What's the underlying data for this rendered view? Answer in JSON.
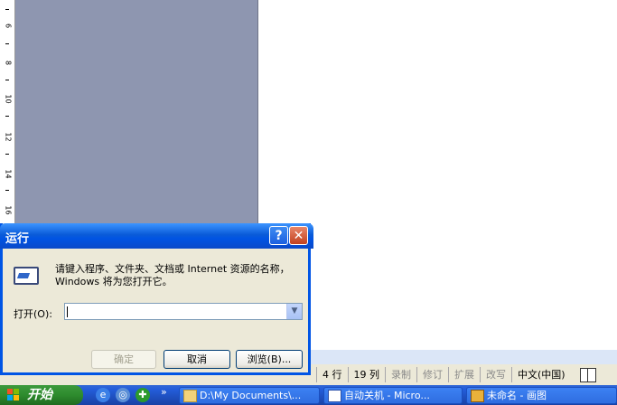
{
  "ruler": {
    "numbers": [
      "6",
      "8",
      "10",
      "12",
      "14",
      "16"
    ]
  },
  "dialog": {
    "title": "运行",
    "help_label": "?",
    "close_label": "✕",
    "description": "请键入程序、文件夹、文档或 Internet 资源的名称，Windows 将为您打开它。",
    "open_label": "打开(O):",
    "open_value": "",
    "ok_label": "确定",
    "cancel_label": "取消",
    "browse_label": "浏览(B)..."
  },
  "statusbar": {
    "line": "4 行",
    "column": "19 列",
    "rec": "录制",
    "trk": "修订",
    "ext": "扩展",
    "ovr": "改写",
    "language": "中文(中国)"
  },
  "taskbar": {
    "start_label": "开始",
    "quicklaunch_chevron": "»",
    "tasks": [
      {
        "label": "D:\\My Documents\\...",
        "icon": "folder-icon"
      },
      {
        "label": "自动关机 - Micro...",
        "icon": "word-icon"
      },
      {
        "label": "未命名 - 画图",
        "icon": "paint-icon"
      }
    ]
  },
  "colors": {
    "canvas_gray": "#8e96b0",
    "xp_blue": "#0054e3",
    "start_green": "#2e8b2e"
  }
}
